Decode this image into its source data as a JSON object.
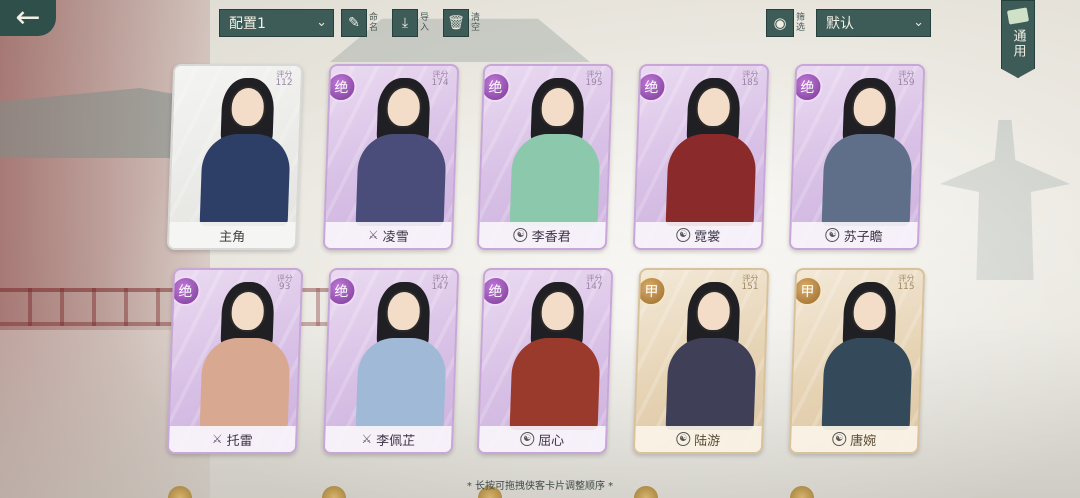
{
  "topbar": {
    "config_select": "配置1",
    "rename_label": "命名",
    "import_label": "导入",
    "delete_label": "清空",
    "filter_label": "筛选",
    "sort_select": "默认",
    "general_tab": "通用"
  },
  "rating_label": "评分",
  "cards": [
    {
      "name": "主角",
      "rating": "112",
      "tier": "",
      "icon": "none",
      "style": "main",
      "body_color": "#2d3f66"
    },
    {
      "name": "凌雪",
      "rating": "174",
      "tier": "绝",
      "icon": "sword-icon",
      "style": "jue",
      "body_color": "#4a4d7a"
    },
    {
      "name": "李香君",
      "rating": "195",
      "tier": "绝",
      "icon": "school-icon",
      "style": "jue",
      "body_color": "#8cc9ac"
    },
    {
      "name": "霓裳",
      "rating": "185",
      "tier": "绝",
      "icon": "school-icon",
      "style": "jue",
      "body_color": "#8a2a2a"
    },
    {
      "name": "苏子瞻",
      "rating": "159",
      "tier": "绝",
      "icon": "school-icon",
      "style": "jue",
      "body_color": "#5f6f8a"
    },
    {
      "name": "托雷",
      "rating": "93",
      "tier": "绝",
      "icon": "sword-icon",
      "style": "jue",
      "body_color": "#d9a890"
    },
    {
      "name": "李佩芷",
      "rating": "147",
      "tier": "绝",
      "icon": "sword-icon",
      "style": "jue",
      "body_color": "#9fb9d6"
    },
    {
      "name": "屈心",
      "rating": "147",
      "tier": "绝",
      "icon": "school-icon",
      "style": "jue",
      "body_color": "#9a3a2c"
    },
    {
      "name": "陆游",
      "rating": "151",
      "tier": "甲",
      "icon": "school-icon",
      "style": "jia",
      "body_color": "#3f3f58"
    },
    {
      "name": "唐婉",
      "rating": "115",
      "tier": "甲",
      "icon": "school-icon",
      "style": "jia",
      "body_color": "#344a5a"
    }
  ],
  "hint": "* 长按可拖拽侠客卡片调整顺序 *"
}
